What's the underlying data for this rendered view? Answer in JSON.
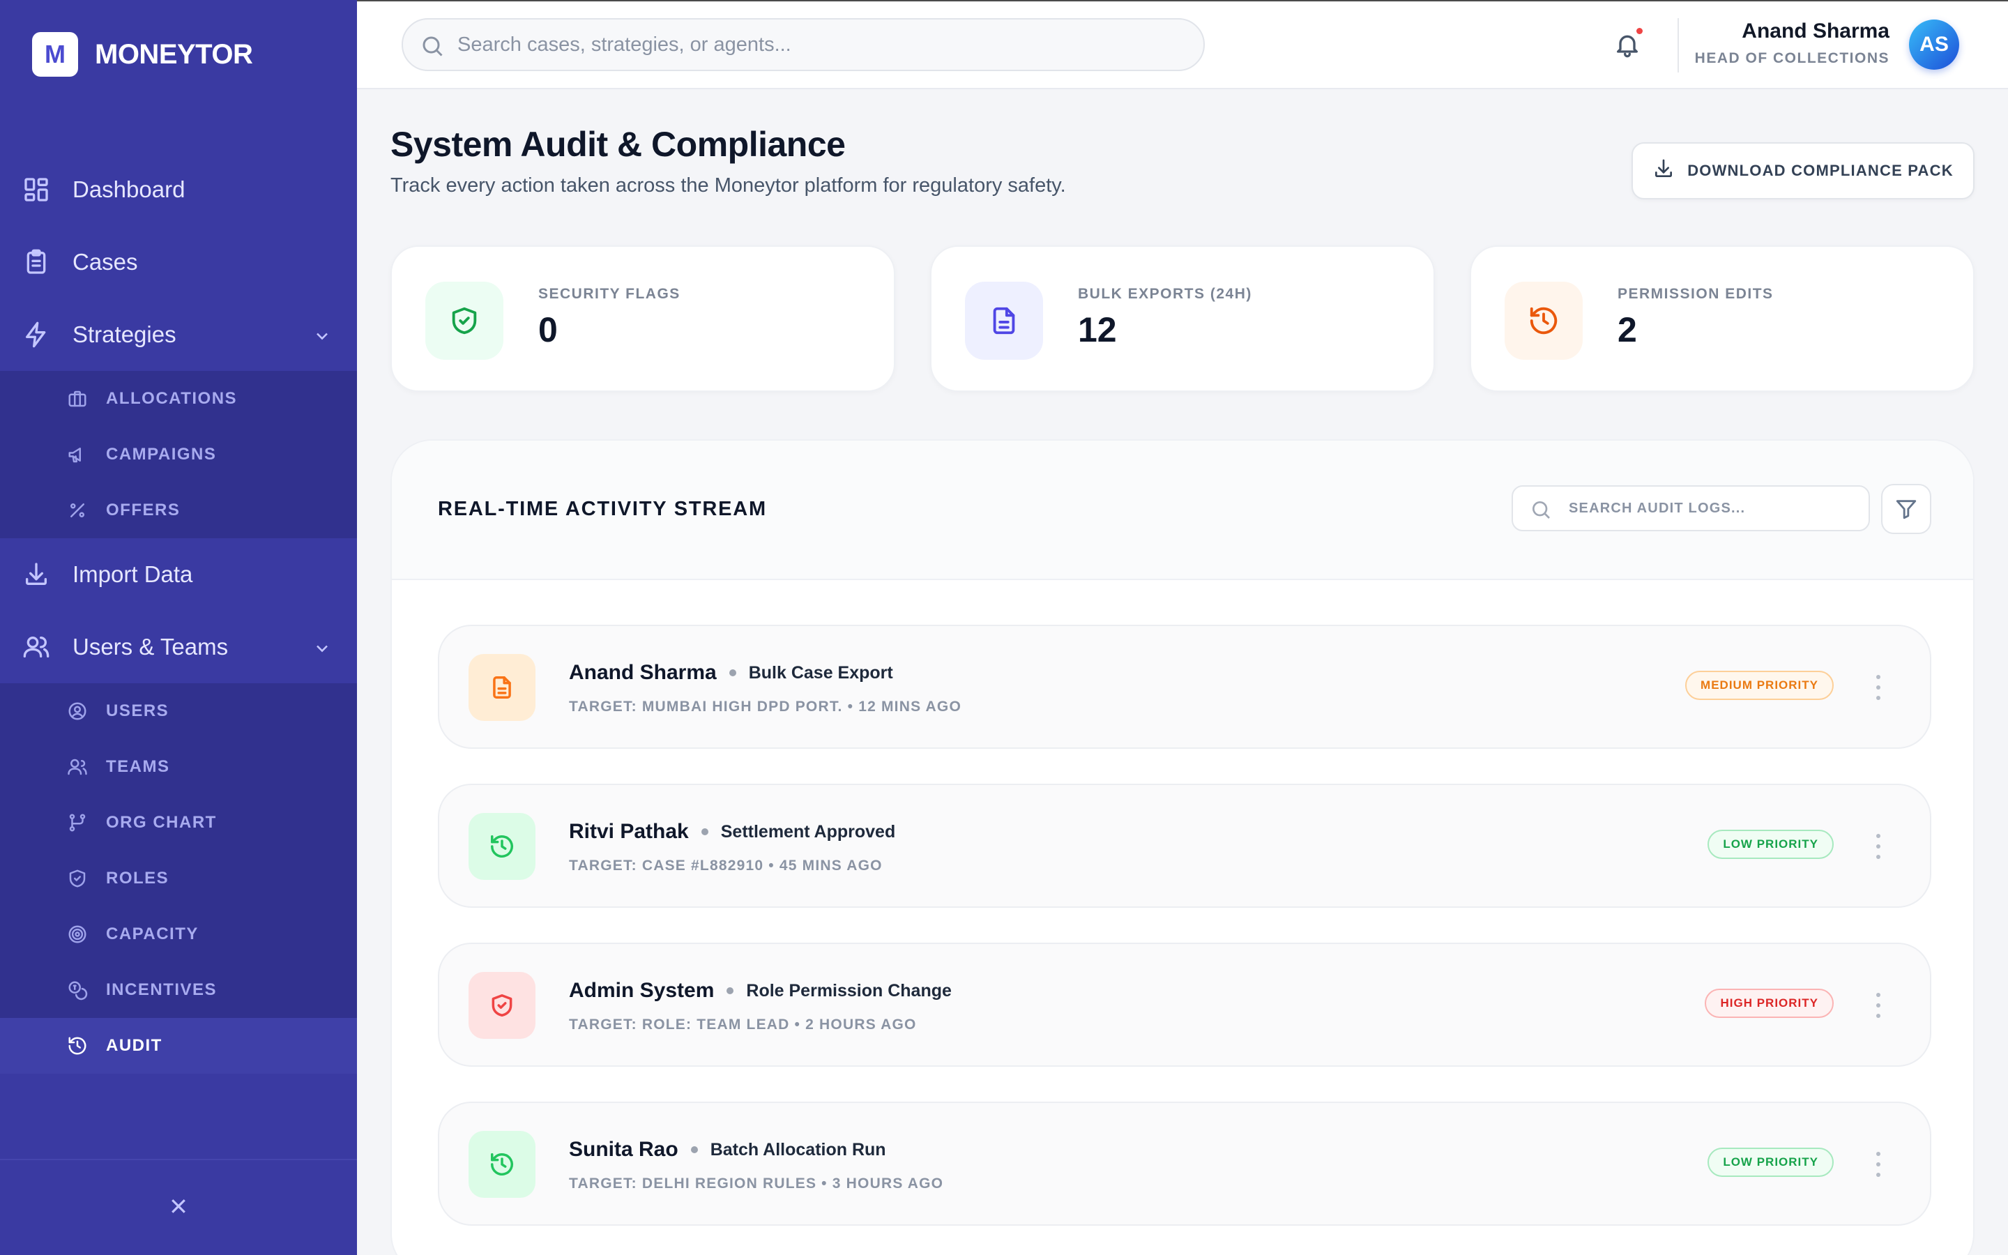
{
  "brand": {
    "logo_letter": "M",
    "name": "MONEYTOR"
  },
  "sidebar": {
    "items": [
      {
        "label": "Dashboard",
        "icon": "grid-icon"
      },
      {
        "label": "Cases",
        "icon": "clipboard-icon"
      },
      {
        "label": "Strategies",
        "icon": "bolt-icon",
        "expanded": true,
        "children": [
          {
            "label": "ALLOCATIONS",
            "icon": "briefcase-icon"
          },
          {
            "label": "CAMPAIGNS",
            "icon": "megaphone-icon"
          },
          {
            "label": "OFFERS",
            "icon": "percent-icon"
          }
        ]
      },
      {
        "label": "Import Data",
        "icon": "download-icon"
      },
      {
        "label": "Users & Teams",
        "icon": "users-icon",
        "expanded": true,
        "children": [
          {
            "label": "USERS",
            "icon": "user-circle-icon"
          },
          {
            "label": "TEAMS",
            "icon": "team-icon"
          },
          {
            "label": "ORG CHART",
            "icon": "org-chart-icon"
          },
          {
            "label": "ROLES",
            "icon": "shield-icon"
          },
          {
            "label": "CAPACITY",
            "icon": "target-icon"
          },
          {
            "label": "INCENTIVES",
            "icon": "coins-icon"
          },
          {
            "label": "AUDIT",
            "icon": "history-icon",
            "active": true
          }
        ]
      }
    ]
  },
  "topbar": {
    "search_placeholder": "Search cases, strategies, or agents...",
    "notifications_unread": true,
    "user": {
      "name": "Anand Sharma",
      "role": "HEAD OF COLLECTIONS",
      "initials": "AS"
    }
  },
  "page": {
    "title": "System Audit & Compliance",
    "subtitle": "Track every action taken across the Moneytor platform for regulatory safety.",
    "download_label": "DOWNLOAD COMPLIANCE PACK"
  },
  "stats": [
    {
      "label": "SECURITY FLAGS",
      "value": "0",
      "icon": "shield-check-icon",
      "color": "#16a34a"
    },
    {
      "label": "BULK EXPORTS (24H)",
      "value": "12",
      "icon": "document-icon",
      "color": "#4f46e5"
    },
    {
      "label": "PERMISSION EDITS",
      "value": "2",
      "icon": "history-icon",
      "color": "#ea580c"
    }
  ],
  "stream": {
    "title": "REAL-TIME ACTIVITY STREAM",
    "search_placeholder": "SEARCH AUDIT LOGS...",
    "rows": [
      {
        "name": "Anand Sharma",
        "action": "Bulk Case Export",
        "meta": "TARGET: MUMBAI HIGH DPD PORT. • 12 MINS AGO",
        "priority": "MEDIUM PRIORITY",
        "level": "medium",
        "icon": "document-icon"
      },
      {
        "name": "Ritvi Pathak",
        "action": "Settlement Approved",
        "meta": "TARGET: CASE #L882910 • 45 MINS AGO",
        "priority": "LOW PRIORITY",
        "level": "low",
        "icon": "history-icon"
      },
      {
        "name": "Admin System",
        "action": "Role Permission Change",
        "meta": "TARGET: ROLE: TEAM LEAD • 2 HOURS AGO",
        "priority": "HIGH PRIORITY",
        "level": "high",
        "icon": "shield-check-icon"
      },
      {
        "name": "Sunita Rao",
        "action": "Batch Allocation Run",
        "meta": "TARGET: DELHI REGION RULES • 3 HOURS AGO",
        "priority": "LOW PRIORITY",
        "level": "low",
        "icon": "history-icon"
      }
    ]
  }
}
